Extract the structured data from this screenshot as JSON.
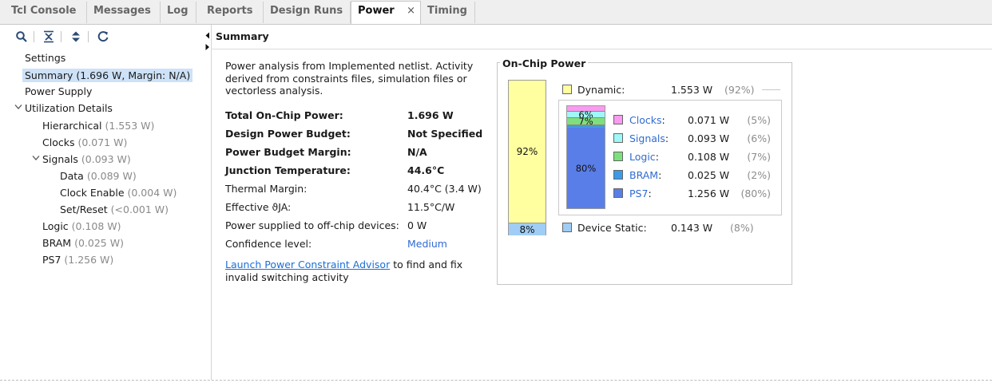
{
  "tabs": [
    {
      "label": "Tcl Console"
    },
    {
      "label": "Messages"
    },
    {
      "label": "Log"
    },
    {
      "label": "Reports"
    },
    {
      "label": "Design Runs"
    },
    {
      "label": "Power",
      "close": "×"
    },
    {
      "label": "Timing"
    }
  ],
  "toolbar_icons": [
    "search-icon",
    "collapse-all-icon",
    "expand-all-icon",
    "refresh-icon"
  ],
  "tree": {
    "settings": "Settings",
    "summary": "Summary (1.696 W, Margin: N/A)",
    "power_supply": "Power Supply",
    "utilization": "Utilization Details",
    "hierarchical": "Hierarchical",
    "hierarchical_val": "(1.553 W)",
    "clocks": "Clocks",
    "clocks_val": "(0.071 W)",
    "signals": "Signals",
    "signals_val": "(0.093 W)",
    "data": "Data",
    "data_val": "(0.089 W)",
    "clock_enable": "Clock Enable",
    "clock_enable_val": "(0.004 W)",
    "set_reset": "Set/Reset",
    "set_reset_val": "(<0.001 W)",
    "logic": "Logic",
    "logic_val": "(0.108 W)",
    "bram": "BRAM",
    "bram_val": "(0.025 W)",
    "ps7": "PS7",
    "ps7_val": "(1.256 W)"
  },
  "summary": {
    "header": "Summary",
    "intro": "Power analysis from Implemented netlist. Activity derived from constraints files, simulation files or vectorless analysis.",
    "rows": [
      {
        "label": "Total On-Chip Power:",
        "value": "1.696 W"
      },
      {
        "label": "Design Power Budget:",
        "value": "Not Specified"
      },
      {
        "label": "Power Budget Margin:",
        "value": "N/A"
      },
      {
        "label": "Junction Temperature:",
        "value": "44.6°C"
      },
      {
        "label": "Thermal Margin:",
        "value": "40.4°C (3.4 W)"
      },
      {
        "label": "Effective ϑJA:",
        "value": "11.5°C/W"
      },
      {
        "label": "Power supplied to off-chip devices:",
        "value": "0 W"
      },
      {
        "label": "Confidence level:",
        "value": "Medium"
      }
    ],
    "advisor_link": "Launch Power Constraint Advisor",
    "advisor_rest": " to find and fix invalid switching activity"
  },
  "onchip": {
    "title": "On-Chip Power",
    "dynamic_label": "Dynamic:",
    "dynamic_value": "1.553 W",
    "dynamic_pct": "(92%)",
    "static_label": "Device Static:",
    "static_value": "0.143 W",
    "static_pct": "(8%)",
    "main_bar": [
      {
        "label": "92%",
        "fraction": 0.92,
        "color": "#ffffa0"
      },
      {
        "label": "8%",
        "fraction": 0.08,
        "color": "#9fcdf5"
      }
    ],
    "components": [
      {
        "name": "Clocks",
        "value": "0.071 W",
        "pct": "(5%)",
        "color": "#f99bf0",
        "fraction": 0.05
      },
      {
        "name": "Signals",
        "value": "0.093 W",
        "pct": "(6%)",
        "color": "#9ff7f7",
        "fraction": 0.06
      },
      {
        "name": "Logic",
        "value": "0.108 W",
        "pct": "(7%)",
        "color": "#7de07d",
        "fraction": 0.07
      },
      {
        "name": "BRAM",
        "value": "0.025 W",
        "pct": "(2%)",
        "color": "#3c9be6",
        "fraction": 0.02
      },
      {
        "name": "PS7",
        "value": "1.256 W",
        "pct": "(80%)",
        "color": "#5a7ee8",
        "fraction": 0.8
      }
    ],
    "dyn_bar_labels": [
      "",
      "6%",
      "7%",
      "",
      "80%"
    ],
    "colon": ":"
  }
}
